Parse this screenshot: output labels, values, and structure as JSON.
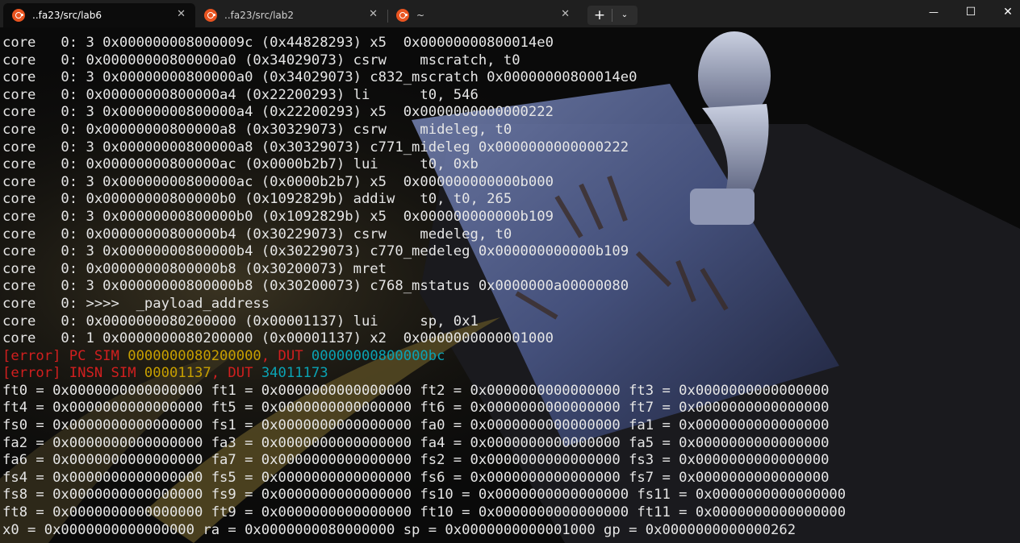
{
  "tabs": [
    {
      "title": "..fa23/src/lab6",
      "close": "✕",
      "active": true
    },
    {
      "title": "..fa23/src/lab2",
      "close": "✕",
      "active": false
    },
    {
      "title": "~",
      "close": "✕",
      "active": false
    }
  ],
  "tab_actions": {
    "new_tab": "+",
    "dropdown": "⌄"
  },
  "window_controls": {
    "minimize": "—",
    "maximize": "☐",
    "close": "✕"
  },
  "colors": {
    "error_red": "#d21f1f",
    "sim_yellow": "#c8a000",
    "dut_cyan": "#0aa3b4",
    "ubuntu_orange": "#e95420"
  },
  "terminal": {
    "lines": [
      [
        {
          "t": "core   0: 3 0x000000008000009c (0x44828293) x5  0x00000000800014e0"
        }
      ],
      [
        {
          "t": "core   0: 0x00000000800000a0 (0x34029073) csrw    mscratch, t0"
        }
      ],
      [
        {
          "t": "core   0: 3 0x00000000800000a0 (0x34029073) c832_mscratch 0x00000000800014e0"
        }
      ],
      [
        {
          "t": "core   0: 0x00000000800000a4 (0x22200293) li      t0, 546"
        }
      ],
      [
        {
          "t": "core   0: 3 0x00000000800000a4 (0x22200293) x5  0x0000000000000222"
        }
      ],
      [
        {
          "t": "core   0: 0x00000000800000a8 (0x30329073) csrw    mideleg, t0"
        }
      ],
      [
        {
          "t": "core   0: 3 0x00000000800000a8 (0x30329073) c771_mideleg 0x0000000000000222"
        }
      ],
      [
        {
          "t": "core   0: 0x00000000800000ac (0x0000b2b7) lui     t0, 0xb"
        }
      ],
      [
        {
          "t": "core   0: 3 0x00000000800000ac (0x0000b2b7) x5  0x000000000000b000"
        }
      ],
      [
        {
          "t": "core   0: 0x00000000800000b0 (0x1092829b) addiw   t0, t0, 265"
        }
      ],
      [
        {
          "t": "core   0: 3 0x00000000800000b0 (0x1092829b) x5  0x000000000000b109"
        }
      ],
      [
        {
          "t": "core   0: 0x00000000800000b4 (0x30229073) csrw    medeleg, t0"
        }
      ],
      [
        {
          "t": "core   0: 3 0x00000000800000b4 (0x30229073) c770_medeleg 0x000000000000b109"
        }
      ],
      [
        {
          "t": "core   0: 0x00000000800000b8 (0x30200073) mret"
        }
      ],
      [
        {
          "t": "core   0: 3 0x00000000800000b8 (0x30200073) c768_mstatus 0x0000000a00000080"
        }
      ],
      [
        {
          "t": "core   0: >>>>  _payload_address"
        }
      ],
      [
        {
          "t": "core   0: 0x0000000080200000 (0x00001137) lui     sp, 0x1"
        }
      ],
      [
        {
          "t": "core   0: 1 0x0000000080200000 (0x00001137) x2  0x0000000000001000"
        }
      ],
      [
        {
          "t": "[error] PC SIM ",
          "c": "red"
        },
        {
          "t": "0000000080200000",
          "c": "yellow"
        },
        {
          "t": ", DUT ",
          "c": "red"
        },
        {
          "t": "00000000800000bc",
          "c": "cyan"
        }
      ],
      [
        {
          "t": "[error] INSN SIM ",
          "c": "red"
        },
        {
          "t": "00001137",
          "c": "yellow"
        },
        {
          "t": ", DUT ",
          "c": "red"
        },
        {
          "t": "34011173",
          "c": "cyan"
        }
      ],
      [
        {
          "t": "ft0 = 0x0000000000000000 ft1 = 0x0000000000000000 ft2 = 0x0000000000000000 ft3 = 0x0000000000000000"
        }
      ],
      [
        {
          "t": "ft4 = 0x0000000000000000 ft5 = 0x0000000000000000 ft6 = 0x0000000000000000 ft7 = 0x0000000000000000"
        }
      ],
      [
        {
          "t": "fs0 = 0x0000000000000000 fs1 = 0x0000000000000000 fa0 = 0x0000000000000000 fa1 = 0x0000000000000000"
        }
      ],
      [
        {
          "t": "fa2 = 0x0000000000000000 fa3 = 0x0000000000000000 fa4 = 0x0000000000000000 fa5 = 0x0000000000000000"
        }
      ],
      [
        {
          "t": "fa6 = 0x0000000000000000 fa7 = 0x0000000000000000 fs2 = 0x0000000000000000 fs3 = 0x0000000000000000"
        }
      ],
      [
        {
          "t": "fs4 = 0x0000000000000000 fs5 = 0x0000000000000000 fs6 = 0x0000000000000000 fs7 = 0x0000000000000000"
        }
      ],
      [
        {
          "t": "fs8 = 0x0000000000000000 fs9 = 0x0000000000000000 fs10 = 0x0000000000000000 fs11 = 0x0000000000000000"
        }
      ],
      [
        {
          "t": "ft8 = 0x0000000000000000 ft9 = 0x0000000000000000 ft10 = 0x0000000000000000 ft11 = 0x0000000000000000"
        }
      ],
      [
        {
          "t": "x0 = 0x0000000000000000 ra = 0x0000000080000000 sp = 0x0000000000001000 gp = 0x0000000000000262"
        }
      ]
    ]
  }
}
